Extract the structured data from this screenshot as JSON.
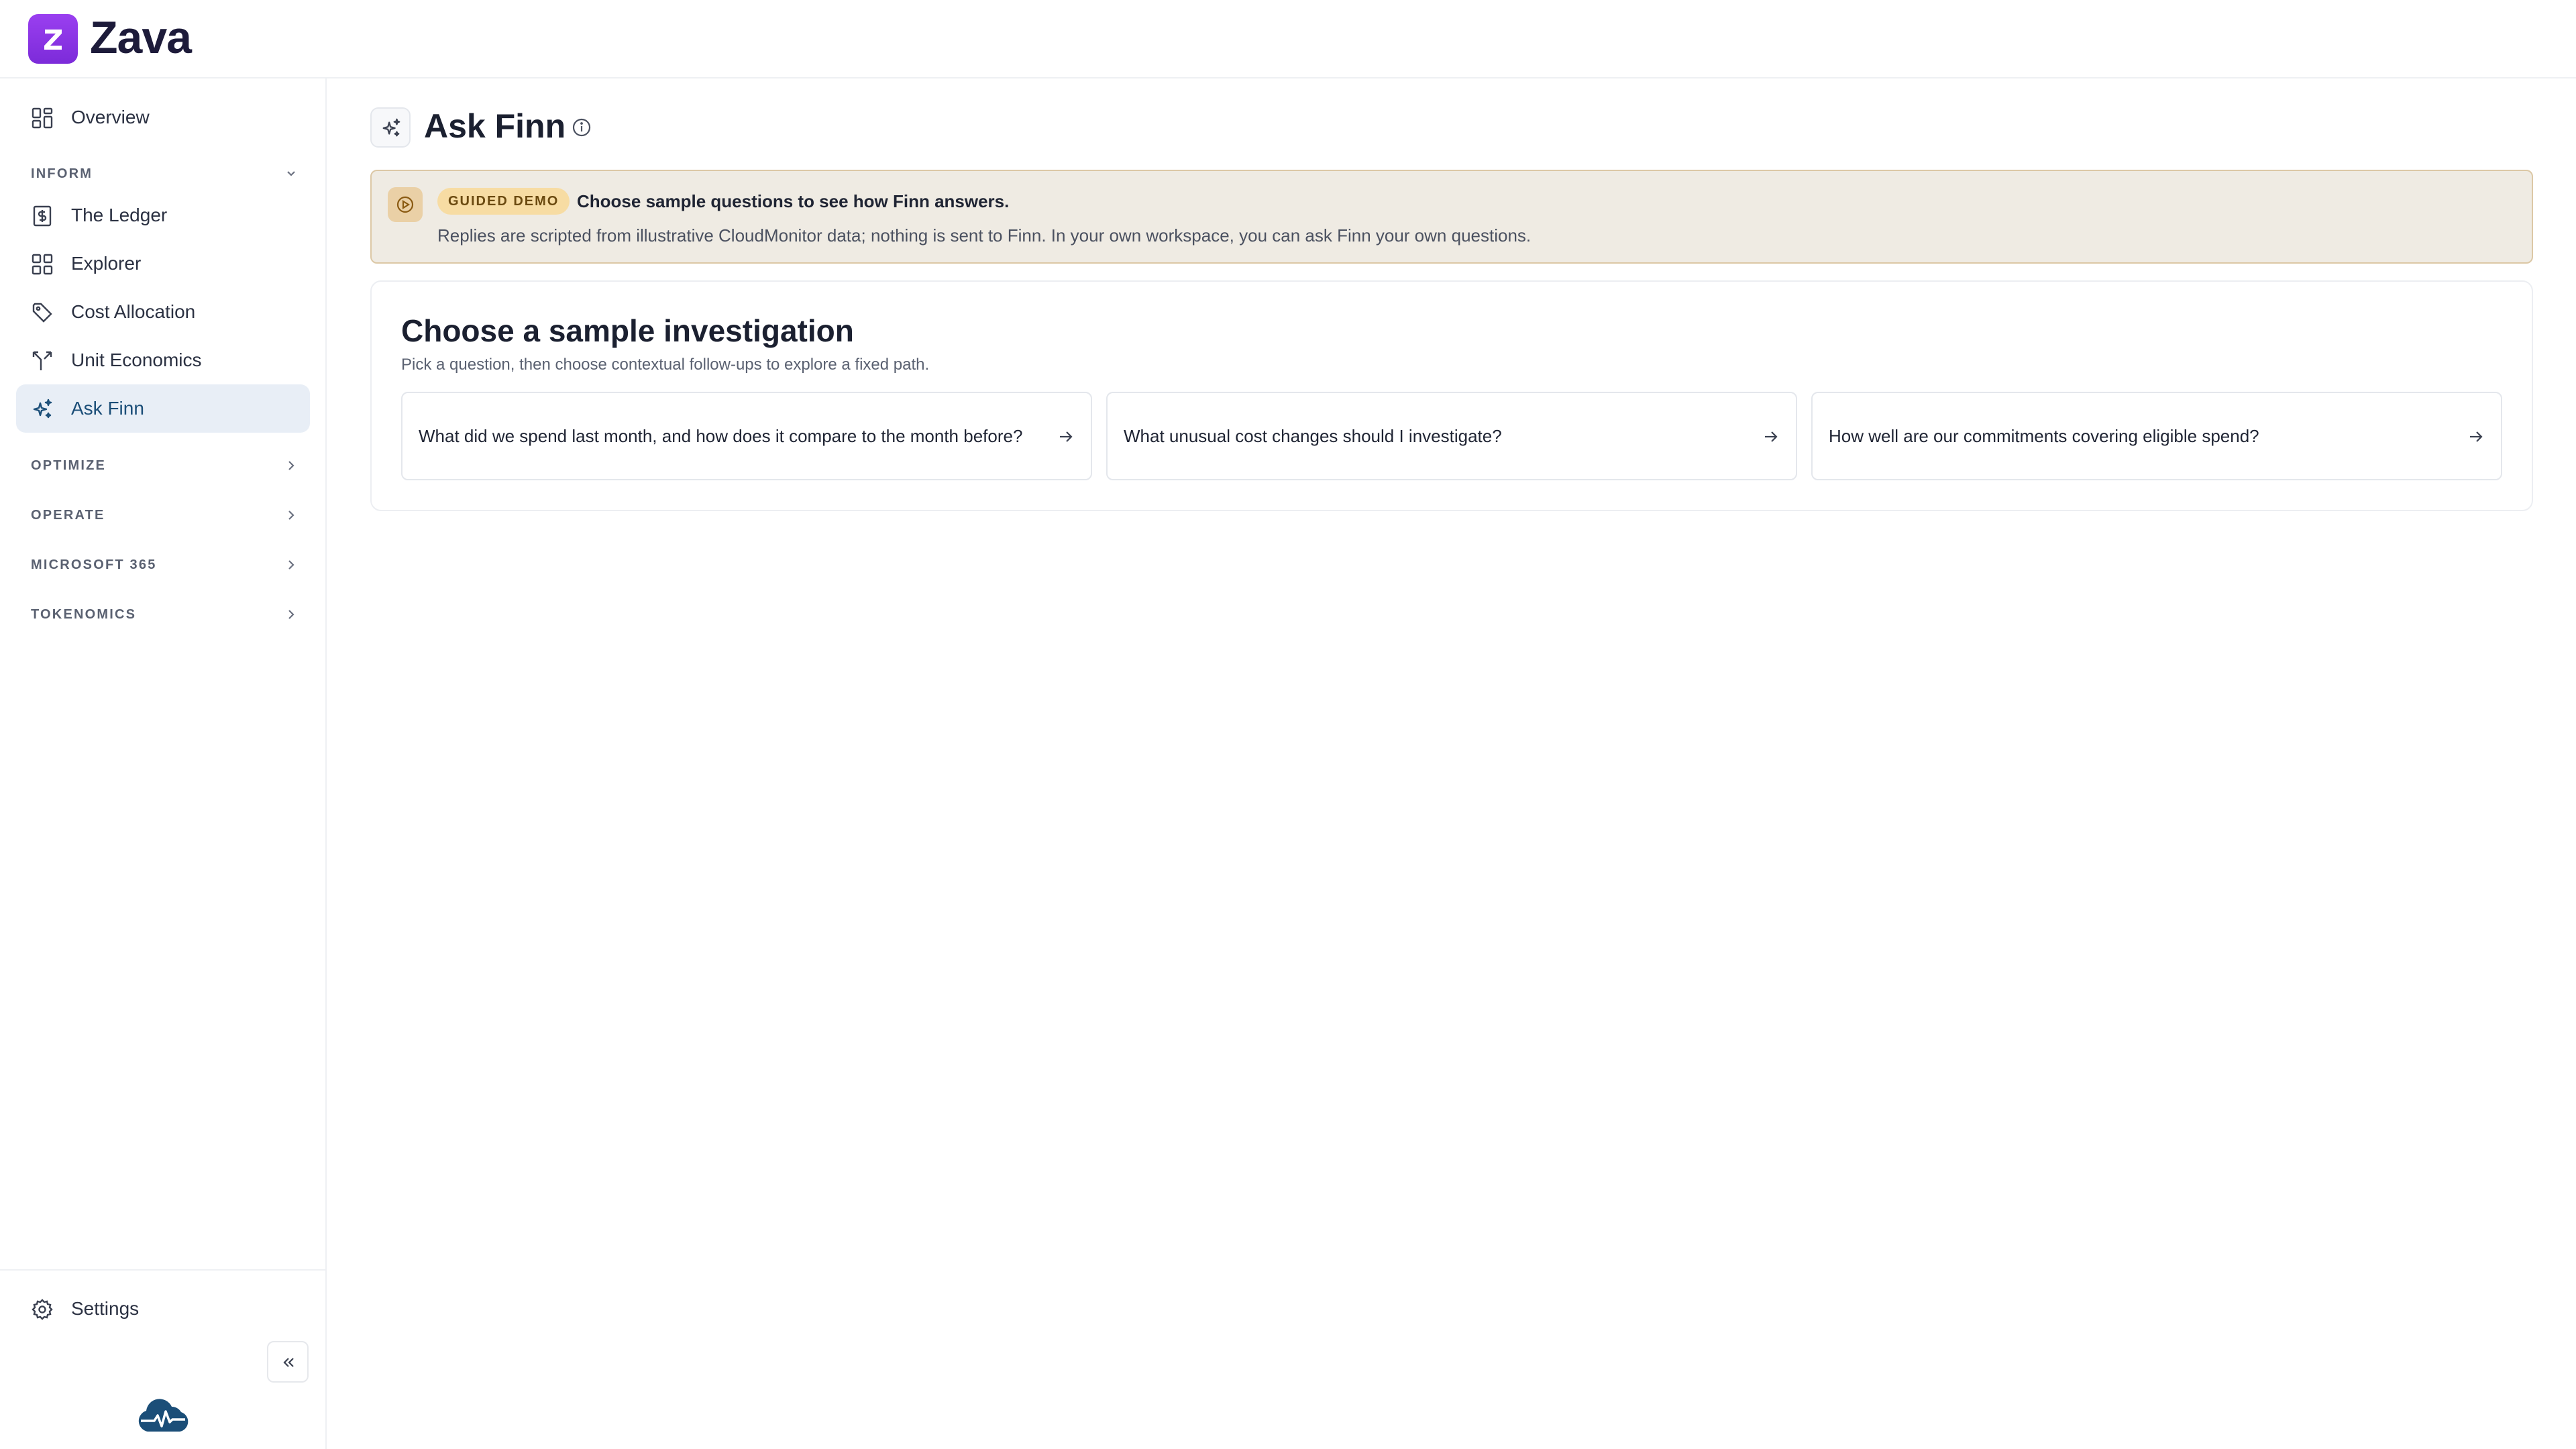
{
  "app": {
    "name": "Zava",
    "logo_letter": "Z",
    "brand_color": "#8b35e6"
  },
  "sidebar": {
    "top_item": {
      "label": "Overview",
      "icon": "grid-icon"
    },
    "sections": [
      {
        "label": "INFORM",
        "expanded": true
      },
      {
        "label": "OPTIMIZE",
        "expanded": false
      },
      {
        "label": "OPERATE",
        "expanded": false
      },
      {
        "label": "MICROSOFT 365",
        "expanded": false
      },
      {
        "label": "TOKENOMICS",
        "expanded": false
      }
    ],
    "inform_items": [
      {
        "label": "The Ledger",
        "icon": "ledger-icon"
      },
      {
        "label": "Explorer",
        "icon": "grid-icon"
      },
      {
        "label": "Cost Allocation",
        "icon": "tag-icon"
      },
      {
        "label": "Unit Economics",
        "icon": "fork-icon"
      },
      {
        "label": "Ask Finn",
        "icon": "sparkles-icon",
        "active": true
      }
    ],
    "settings_label": "Settings"
  },
  "main": {
    "title": "Ask Finn",
    "banner": {
      "badge": "GUIDED DEMO",
      "title": "Choose sample questions to see how Finn answers.",
      "subtitle": "Replies are scripted from illustrative CloudMonitor data; nothing is sent to Finn. In your own workspace, you can ask Finn your own questions."
    },
    "card": {
      "title": "Choose a sample investigation",
      "subtitle": "Pick a question, then choose contextual follow-ups to explore a fixed path.",
      "questions": [
        "What did we spend last month, and how does it compare to the month before?",
        "What unusual cost changes should I investigate?",
        "How well are our commitments covering eligible spend?"
      ]
    }
  }
}
